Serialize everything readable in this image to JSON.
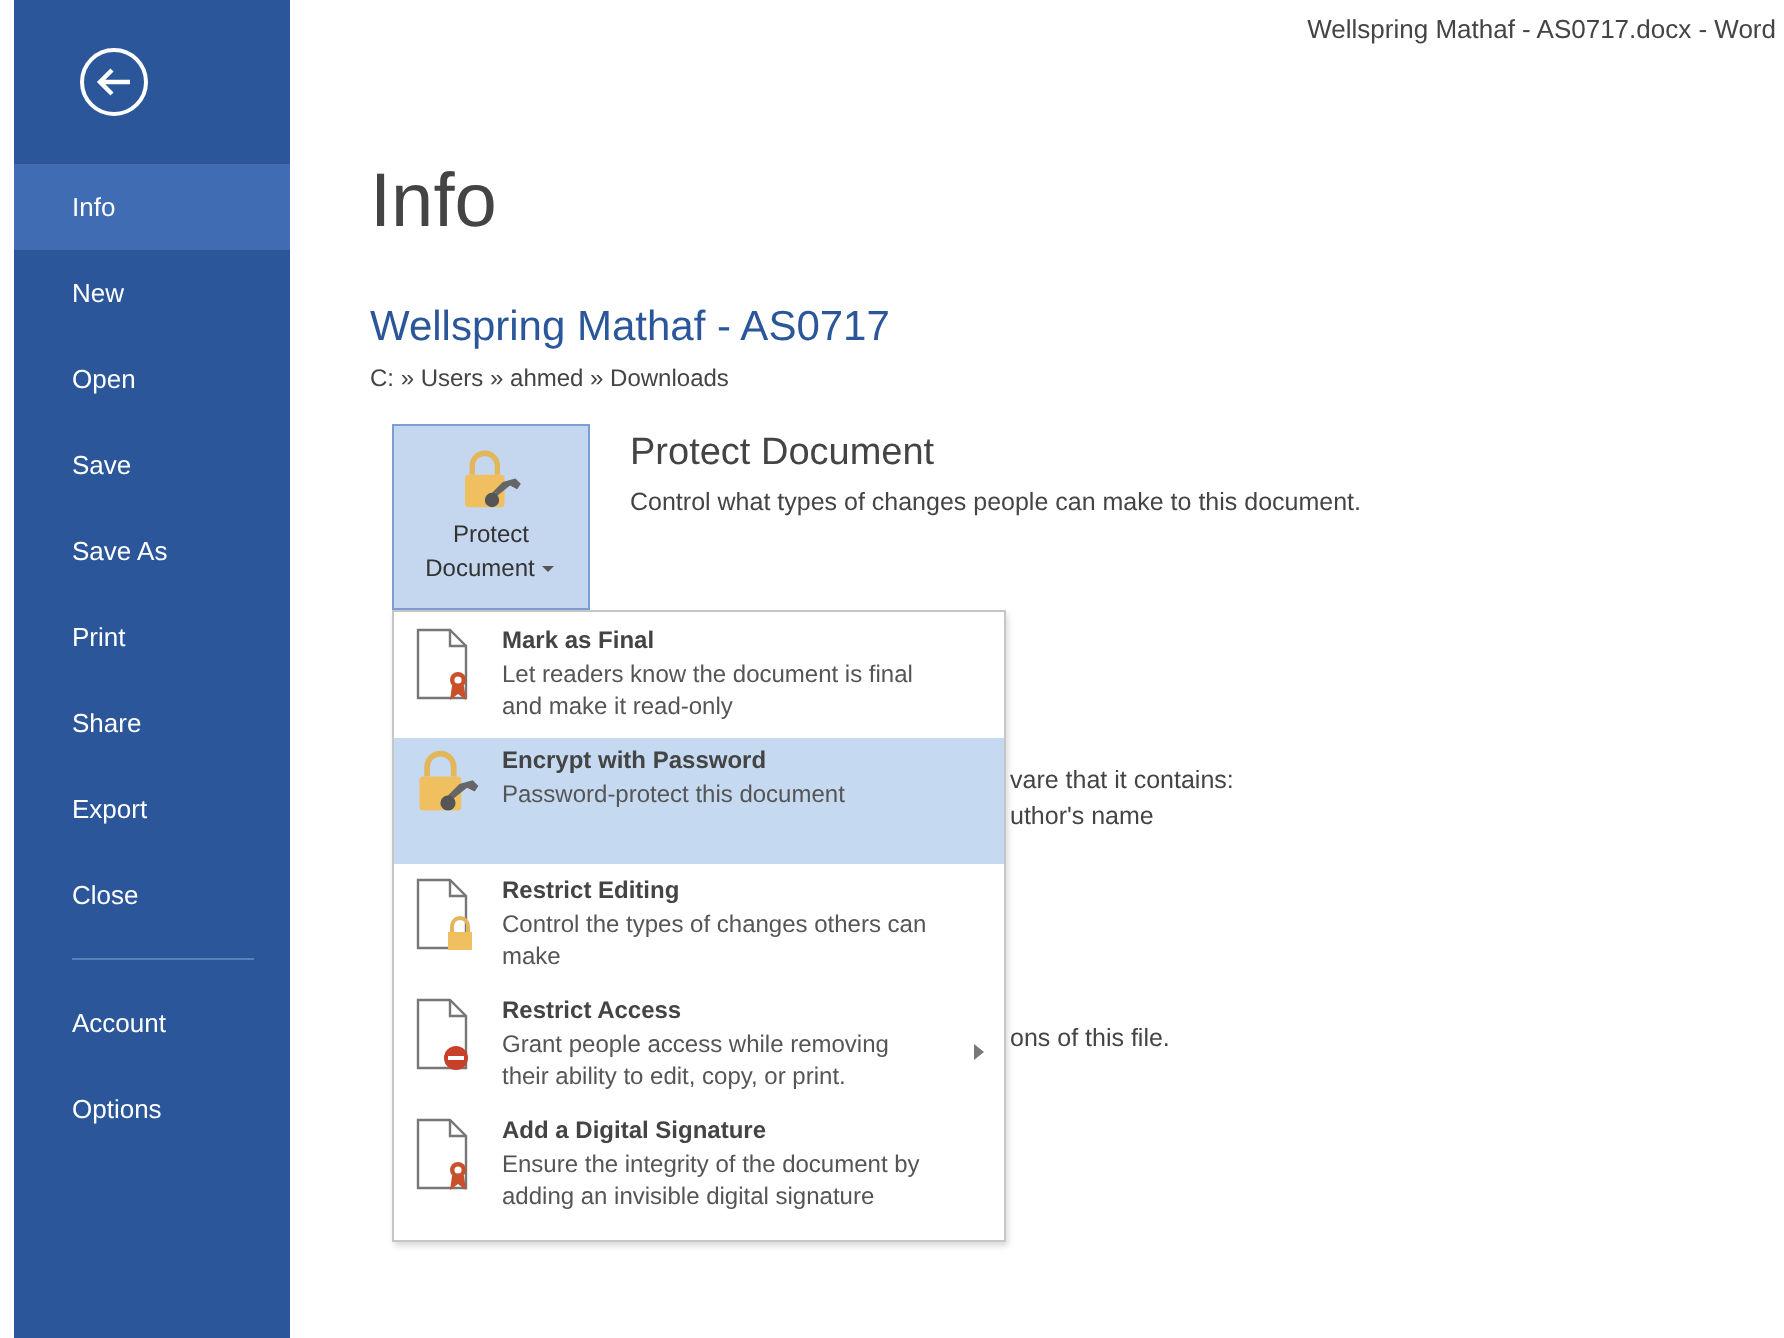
{
  "window": {
    "title": "Wellspring Mathaf - AS0717.docx - Word"
  },
  "sidebar": {
    "items": [
      {
        "label": "Info",
        "selected": true
      },
      {
        "label": "New",
        "selected": false
      },
      {
        "label": "Open",
        "selected": false
      },
      {
        "label": "Save",
        "selected": false
      },
      {
        "label": "Save As",
        "selected": false
      },
      {
        "label": "Print",
        "selected": false
      },
      {
        "label": "Share",
        "selected": false
      },
      {
        "label": "Export",
        "selected": false
      },
      {
        "label": "Close",
        "selected": false
      },
      {
        "label": "Account",
        "selected": false,
        "divider_before": true
      },
      {
        "label": "Options",
        "selected": false
      }
    ]
  },
  "page": {
    "heading": "Info",
    "document_name": "Wellspring Mathaf - AS0717",
    "path": "C: » Users » ahmed » Downloads"
  },
  "protect": {
    "button_lines": [
      "Protect",
      "Document"
    ],
    "expanded": true,
    "title": "Protect Document",
    "description": "Control what types of changes people can make to this document."
  },
  "behind_texts": [
    {
      "text": "vare that it contains:"
    },
    {
      "text": "uthor's name"
    },
    {
      "text": "ons of this file."
    }
  ],
  "menu": {
    "items": [
      {
        "kind": "ribbon",
        "title": "Mark as Final",
        "description": "Let readers know the document is final and make it read-only",
        "selected": false,
        "submenu": false
      },
      {
        "kind": "lock-key",
        "title": "Encrypt with Password",
        "description": "Password-protect this document",
        "selected": true,
        "submenu": false
      },
      {
        "kind": "lock",
        "title": "Restrict Editing",
        "description": "Control the types of changes others can make",
        "selected": false,
        "submenu": false
      },
      {
        "kind": "no-entry",
        "title": "Restrict Access",
        "description": "Grant people access while removing their ability to edit, copy, or print.",
        "selected": false,
        "submenu": true
      },
      {
        "kind": "ribbon",
        "title": "Add a Digital Signature",
        "description": "Ensure the integrity of the document by adding an invisible digital signature",
        "selected": false,
        "submenu": false
      }
    ]
  }
}
